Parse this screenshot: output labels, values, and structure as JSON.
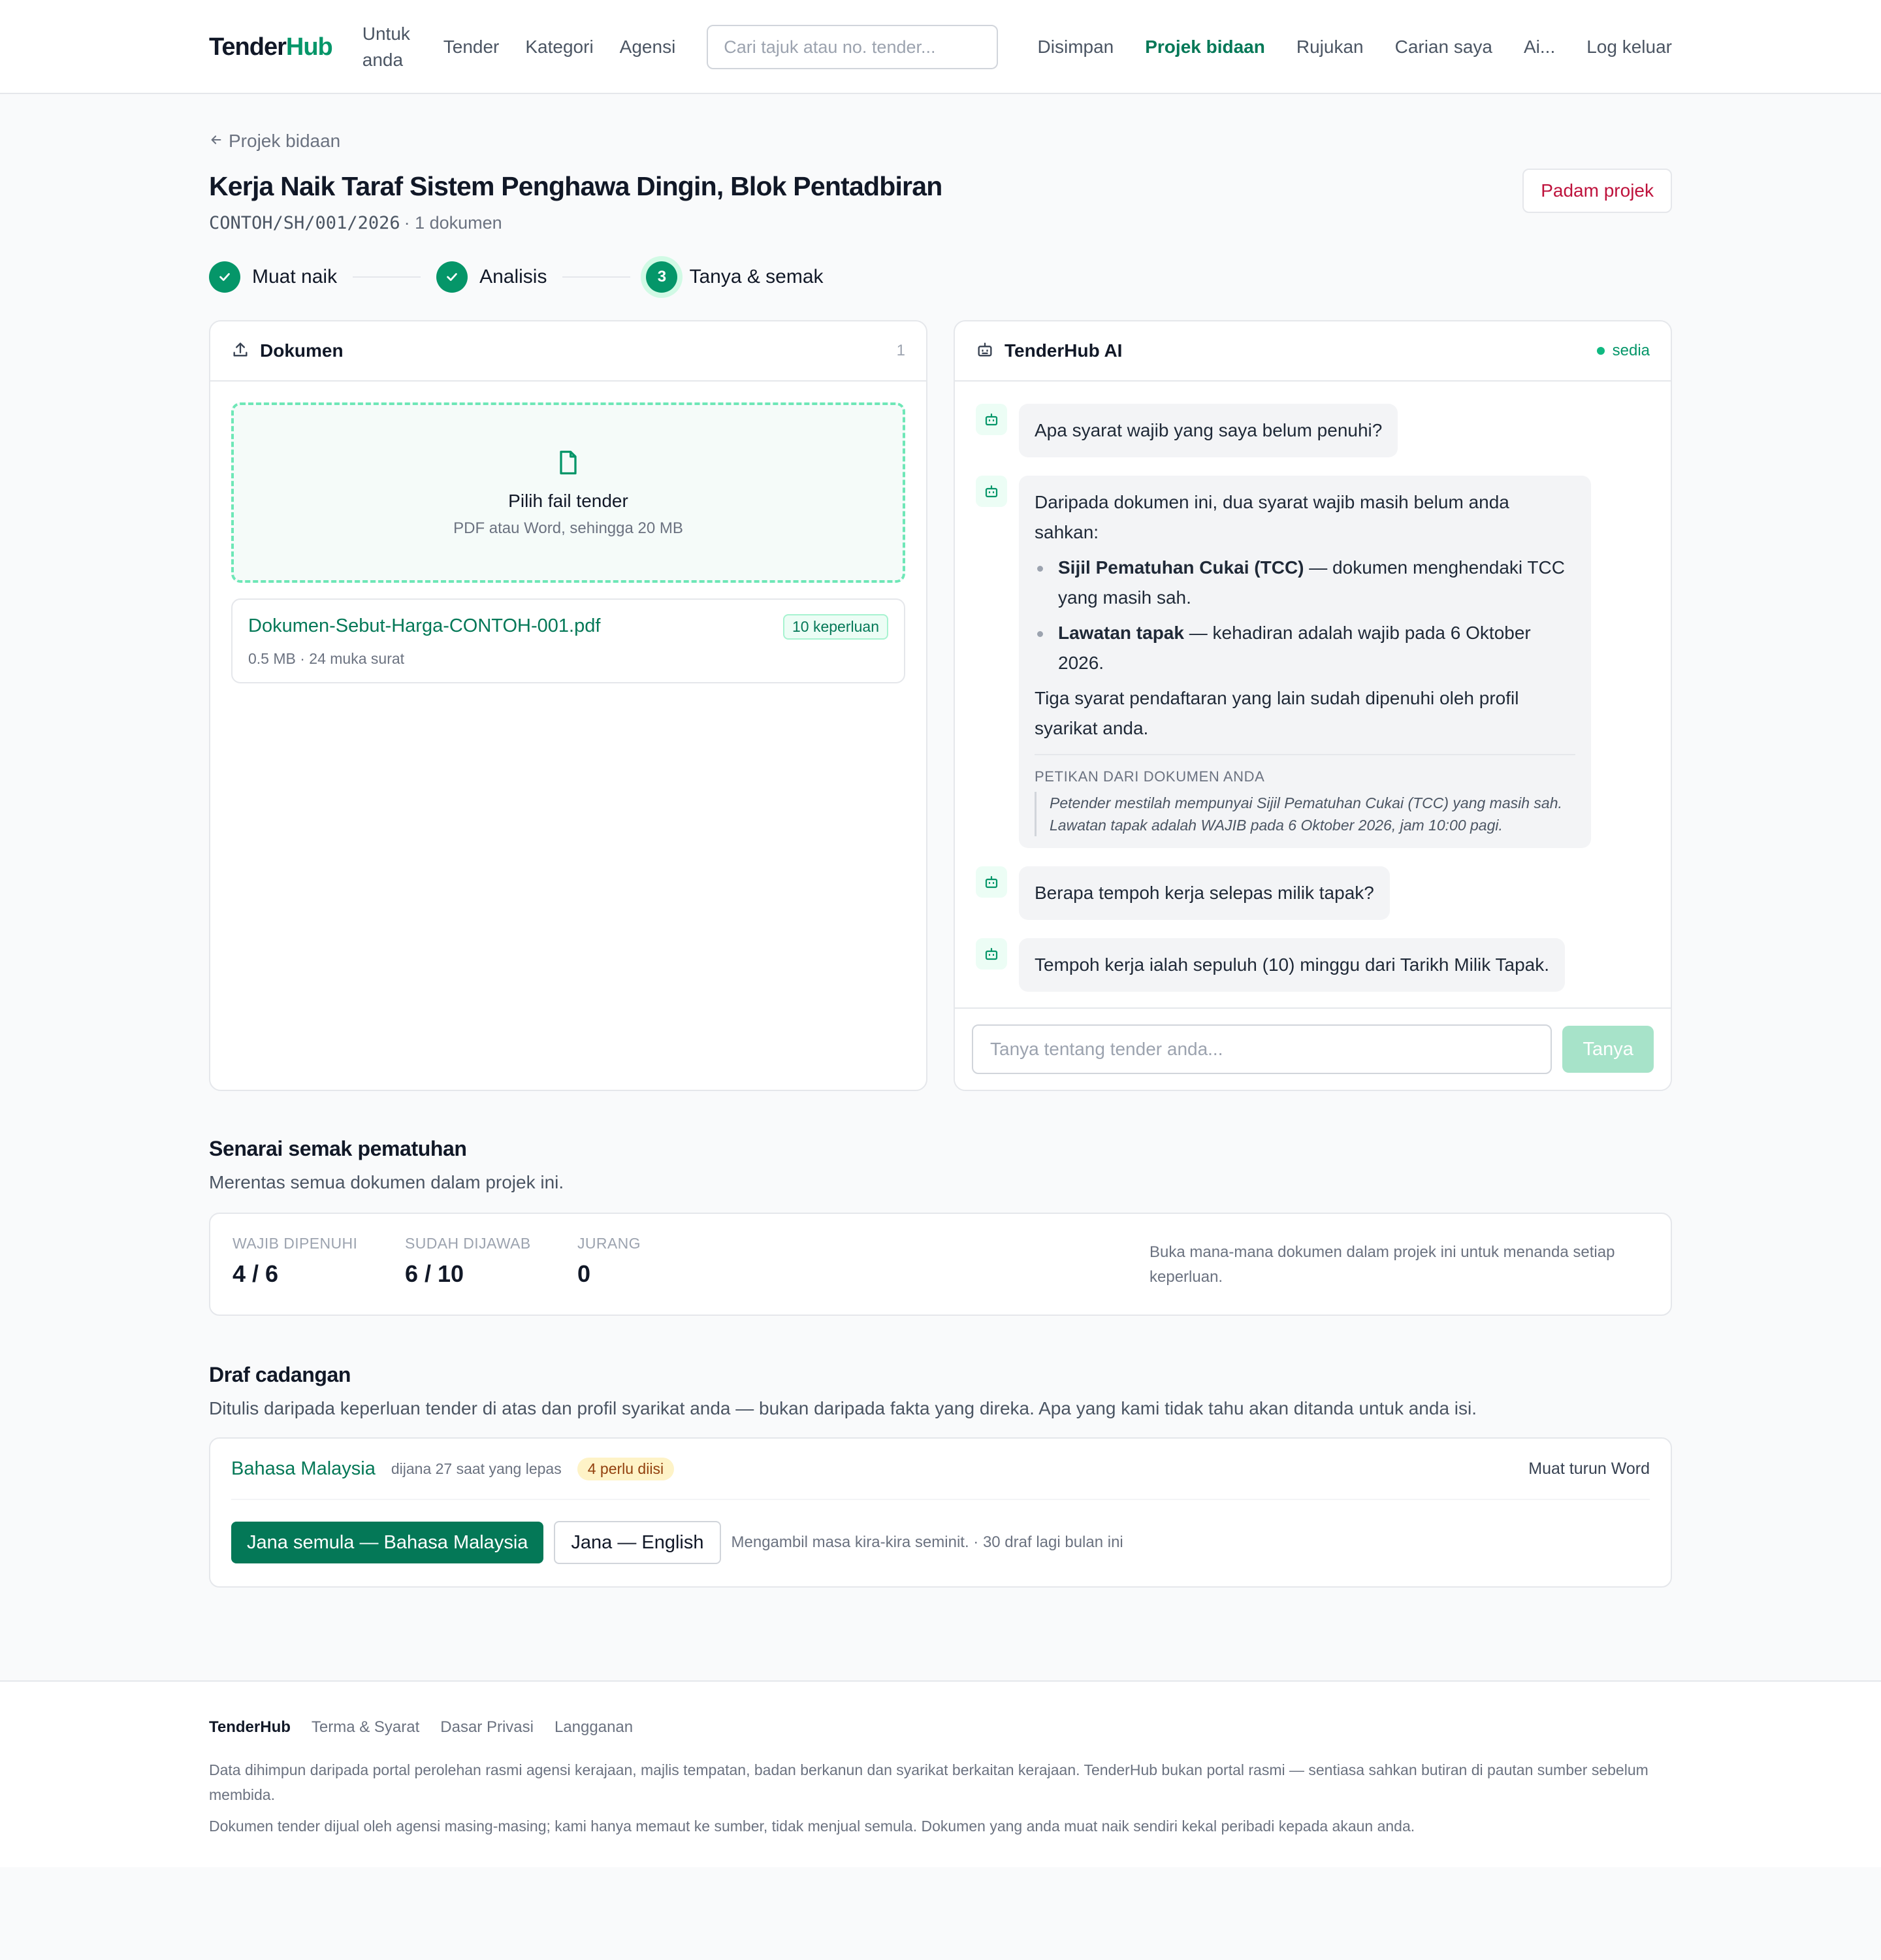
{
  "nav": {
    "logo_a": "Tender",
    "logo_b": "Hub",
    "links": [
      "Untuk anda",
      "Tender",
      "Kategori",
      "Agensi"
    ],
    "search_placeholder": "Cari tajuk atau no. tender...",
    "right_links": [
      "Disimpan",
      "Projek bidaan",
      "Rujukan",
      "Carian saya",
      "Ai...",
      "Log keluar"
    ],
    "active": "Projek bidaan"
  },
  "project": {
    "back": "Projek bidaan",
    "title": "Kerja Naik Taraf Sistem Penghawa Dingin, Blok Pentadbiran",
    "code": "CONTOH/SH/001/2026",
    "docs": "· 1 dokumen",
    "delete_label": "Padam projek"
  },
  "steps": [
    {
      "num": "✓",
      "label": "Muat naik"
    },
    {
      "num": "✓",
      "label": "Analisis"
    },
    {
      "num": "3",
      "label": "Tanya & semak"
    }
  ],
  "documents": {
    "title": "Dokumen",
    "count": "1",
    "drop_title": "Pilih fail tender",
    "drop_hint": "PDF atau Word, sehingga 20 MB",
    "file_name": "Dokumen-Sebut-Harga-CONTOH-001.pdf",
    "file_meta": "0.5 MB · 24 muka surat",
    "file_badge": "10 keperluan"
  },
  "ai": {
    "title": "TenderHub AI",
    "status": "sedia",
    "q1": "Apa syarat wajib yang saya belum penuhi?",
    "a1_intro": "Daripada dokumen ini, dua syarat wajib masih belum anda sahkan:",
    "a1_items": [
      {
        "bold": "Sijil Pematuhan Cukai (TCC)",
        "rest": " — dokumen menghendaki TCC yang masih sah."
      },
      {
        "bold": "Lawatan tapak",
        "rest": " — kehadiran adalah wajib pada 6 Oktober 2026."
      }
    ],
    "a1_after": "Tiga syarat pendaftaran yang lain sudah dipenuhi oleh profil syarikat anda.",
    "excerpt_head": "PETIKAN DARI DOKUMEN ANDA",
    "excerpts": [
      "Petender mestilah mempunyai Sijil Pematuhan Cukai (TCC) yang masih sah.",
      "Lawatan tapak adalah WAJIB pada 6 Oktober 2026, jam 10:00 pagi."
    ],
    "q2": "Berapa tempoh kerja selepas milik tapak?",
    "a2": "Tempoh kerja ialah sepuluh (10) minggu dari Tarikh Milik Tapak.",
    "ask_placeholder": "Tanya tentang tender anda...",
    "ask_button": "Tanya"
  },
  "compliance": {
    "title": "Senarai semak pematuhan",
    "subtitle": "Merentas semua dokumen dalam projek ini.",
    "stats": [
      {
        "label": "WAJIB DIPENUHI",
        "value": "4 / 6"
      },
      {
        "label": "SUDAH DIJAWAB",
        "value": "6 / 10"
      },
      {
        "label": "JURANG",
        "value": "0"
      }
    ],
    "hint": "Buka mana-mana dokumen dalam projek ini untuk menanda setiap keperluan."
  },
  "draft": {
    "title": "Draf cadangan",
    "subtitle": "Ditulis daripada keperluan tender di atas dan profil syarikat anda — bukan daripada fakta yang direka. Apa yang kami tidak tahu akan ditanda untuk anda isi.",
    "lang": "Bahasa Malaysia",
    "when": "dijana 27 saat yang lepas",
    "pill": "4 perlu diisi",
    "download": "Muat turun Word",
    "regen": "Jana semula — Bahasa Malaysia",
    "gen_en": "Jana — English",
    "note": "Mengambil masa kira-kira seminit. · 30 draf lagi bulan ini"
  },
  "footer": {
    "brand": "TenderHub",
    "links": [
      "Terma & Syarat",
      "Dasar Privasi",
      "Langganan"
    ],
    "p1": "Data dihimpun daripada portal perolehan rasmi agensi kerajaan, majlis tempatan, badan berkanun dan syarikat berkaitan kerajaan. TenderHub bukan portal rasmi — sentiasa sahkan butiran di pautan sumber sebelum membida.",
    "p2": "Dokumen tender dijual oleh agensi masing-masing; kami hanya memaut ke sumber, tidak menjual semula. Dokumen yang anda muat naik sendiri kekal peribadi kepada akaun anda."
  },
  "colors": {
    "accent": "#047857",
    "accent_light": "#059669",
    "danger": "#be123c",
    "warn_bg": "#fef3c7"
  }
}
